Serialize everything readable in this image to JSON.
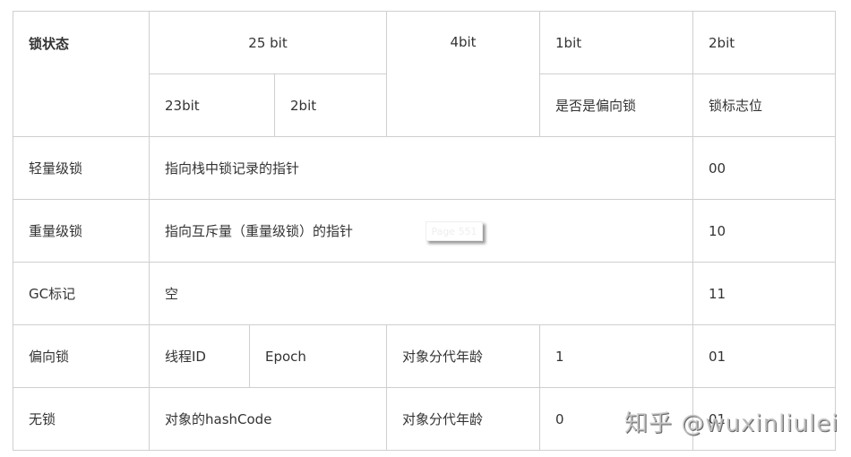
{
  "header": {
    "state": "锁状态",
    "bits25": "25 bit",
    "bits4": "4bit",
    "bits1": "1bit",
    "bits2": "2bit",
    "bits23": "23bit",
    "bits2b": "2bit",
    "biased_flag": "是否是偏向锁",
    "lock_flag": "锁标志位"
  },
  "rows": [
    {
      "state": "轻量级锁",
      "content": "指向栈中锁记录的指针",
      "flag": "00"
    },
    {
      "state": "重量级锁",
      "content": "指向互斥量（重量级锁）的指针",
      "flag": "10"
    },
    {
      "state": "GC标记",
      "content": "空",
      "flag": "11"
    },
    {
      "state": "偏向锁",
      "thread": "线程ID",
      "epoch": "Epoch",
      "age": "对象分代年龄",
      "biased": "1",
      "flag": "01"
    },
    {
      "state": "无锁",
      "hash": "对象的hashCode",
      "age": "对象分代年龄",
      "biased": "0",
      "flag": "01"
    }
  ],
  "tooltip": "Page 551",
  "watermark": "知乎 @wuxinliulei"
}
